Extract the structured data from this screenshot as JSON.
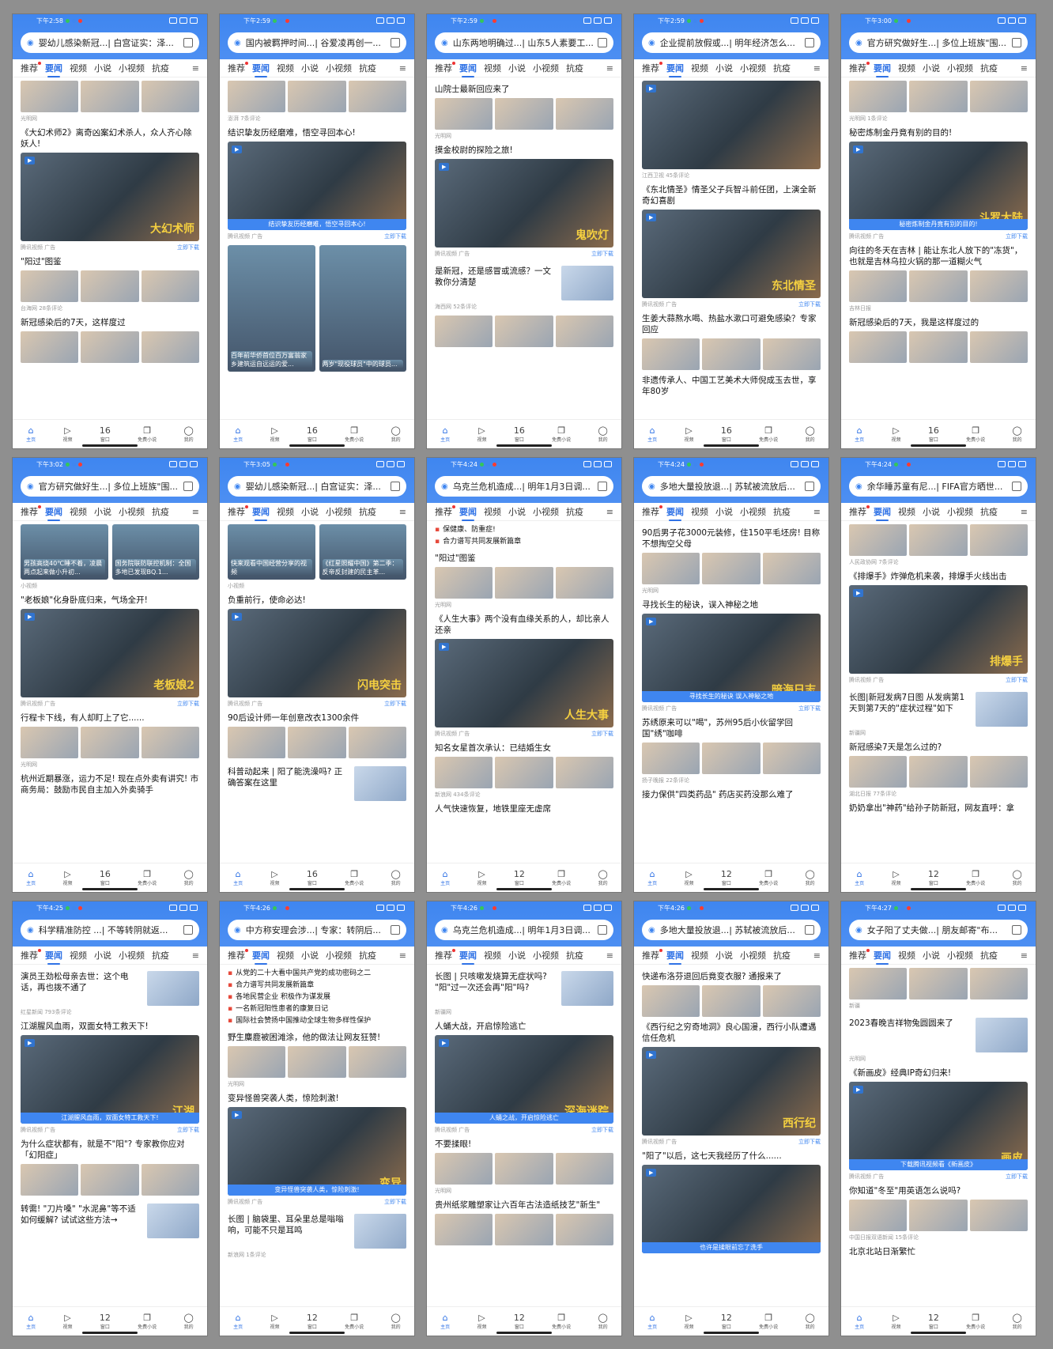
{
  "tabs": [
    "推荐",
    "要闻",
    "视频",
    "小说",
    "小视频",
    "抗疫"
  ],
  "nav": [
    {
      "label": "主页",
      "icon": "home-icon"
    },
    {
      "label": "视频",
      "icon": "play-icon"
    },
    {
      "label": "窗口",
      "icon": "window-icon"
    },
    {
      "label": "免费小说",
      "icon": "book-icon"
    },
    {
      "label": "我的",
      "icon": "user-icon"
    }
  ],
  "screens": [
    {
      "time": "下午2:58",
      "search": "婴幼儿感染新冠...| 白宫证实：泽...",
      "window_count": "16",
      "items": [
        {
          "kind": "row3",
          "meta": "光明网"
        },
        {
          "kind": "big",
          "title": "《大幻术师2》离奇凶案幻术杀人，众人齐心除妖人!",
          "caption": "大幻术师",
          "meta": "腾讯视频  广告",
          "dl": "立即下载"
        },
        {
          "kind": "row3",
          "title": "\"阳过\"图鉴",
          "meta": "台海网 28条评论"
        },
        {
          "kind": "row3",
          "title": "新冠感染后的7天，这样度过",
          "meta": ""
        }
      ]
    },
    {
      "time": "下午2:59",
      "search": "国内被羁押时间...| 谷爱凌再创一...",
      "window_count": "16",
      "items": [
        {
          "kind": "row3",
          "meta": "澎湃 7条评论"
        },
        {
          "kind": "big",
          "title": "结识挚友历经磨难，悟空寻回本心!",
          "banner": "结识挚友历经磨难，悟空寻回本心!",
          "meta": "腾讯视频  广告",
          "dl": "立即下载"
        },
        {
          "kind": "twin",
          "left": "百年前华侨首位百万富翁家乡建筑运自远运的爱...",
          "right": "两岁\"现役球员\"中的球员..."
        }
      ]
    },
    {
      "time": "下午2:59",
      "search": "山东两地明确过...| 山东5人素要工...",
      "window_count": "16",
      "items": [
        {
          "kind": "row3",
          "title": "山院士最新回应来了",
          "meta": "光明网"
        },
        {
          "kind": "big",
          "title": "摸金校尉的探险之旅!",
          "caption": "鬼吹灯",
          "meta": "腾讯视频  广告",
          "dl": "立即下载"
        },
        {
          "kind": "side",
          "title": "是新冠，还是感冒或流感？一文教你分清楚",
          "meta": "海西网 52条评论"
        },
        {
          "kind": "row3",
          "meta": ""
        }
      ]
    },
    {
      "time": "下午2:59",
      "search": "企业提前放假或...| 明年经济怎么...",
      "window_count": "16",
      "items": [
        {
          "kind": "big",
          "meta": "江西卫视 45条评论"
        },
        {
          "kind": "big",
          "title": "《东北情圣》情圣父子兵智斗前任团，上演全新奇幻喜剧",
          "caption": "东北情圣",
          "meta": "腾讯视频  广告",
          "dl": "立即下载"
        },
        {
          "kind": "row3",
          "title": "生姜大蒜熬水喝、热盐水漱口可避免感染？专家回应",
          "meta": ""
        },
        {
          "kind": "plain",
          "title": "非遗传承人、中国工艺美术大师倪成玉去世，享年80岁",
          "meta": ""
        }
      ]
    },
    {
      "time": "下午3:00",
      "search": "官方研究做好生...| 多位上班族\"围...",
      "window_count": "16",
      "items": [
        {
          "kind": "row3",
          "meta": "光明网 1条评论"
        },
        {
          "kind": "big",
          "title": "秘密炼制金丹竟有别的目的!",
          "caption": "斗罗大陆",
          "banner": "秘密炼制金丹竟有别的目的!",
          "meta": "腾讯视频  广告",
          "dl": "立即下载"
        },
        {
          "kind": "row3",
          "title": "向往的冬天在吉林 | 能让东北人放下的\"冻货\"，也就是吉林乌拉火锅的那一道糊火气",
          "meta": "吉林日报"
        },
        {
          "kind": "row3",
          "title": "新冠感染后的7天，我是这样度过的",
          "meta": ""
        }
      ]
    },
    {
      "time": "下午3:02",
      "search": "官方研究做好生...| 多位上班族\"围...",
      "window_count": "16",
      "items": [
        {
          "kind": "twin2",
          "left": "男孩高烧40℃睡不着，凌晨两点起来做小升初...",
          "right": "国务院联防联控机制：全国多地已发现BQ.1...",
          "meta": "小视频"
        },
        {
          "kind": "big",
          "title": "\"老板娘\"化身卧底归来，气场全开!",
          "caption": "老板娘2",
          "meta": "腾讯视频  广告",
          "dl": "立即下载"
        },
        {
          "kind": "row3",
          "title": "行程卡下线，有人却盯上了它......",
          "meta": "光明网"
        },
        {
          "kind": "plain",
          "title": "杭州近期暴涨，运力不足! 现在点外卖有讲究! 市商务局：鼓励市民自主加入外卖骑手",
          "meta": ""
        }
      ]
    },
    {
      "time": "下午3:05",
      "search": "婴幼儿感染新冠...| 白宫证实：泽...",
      "window_count": "16",
      "items": [
        {
          "kind": "twin2",
          "left": "快来观看中国经营分享的视频",
          "right": "《红星照耀中国》第二季：反帝反封建的民主革...",
          "meta": "小视频"
        },
        {
          "kind": "big",
          "title": "负重前行，使命必达!",
          "caption": "闪电突击",
          "meta": "腾讯视频  广告",
          "dl": "立即下载"
        },
        {
          "kind": "row3",
          "title": "90后设计师一年创意改衣1300余件",
          "meta": ""
        },
        {
          "kind": "side",
          "title": "科普动起来 | 阳了能洗澡吗? 正确答案在这里",
          "meta": ""
        }
      ]
    },
    {
      "time": "下午4:24",
      "search": "乌克兰危机造成...| 明年1月3日调...",
      "window_count": "12",
      "items": [
        {
          "kind": "list",
          "lines": [
            "保健康、防重症!",
            "合力谱写共同发展新篇章"
          ]
        },
        {
          "kind": "row3",
          "title": "\"阳过\"图鉴",
          "meta": "光明网"
        },
        {
          "kind": "big",
          "title": "《人生大事》两个没有血缘关系的人，却比亲人还亲",
          "caption": "人生大事",
          "meta": "腾讯视频  广告",
          "dl": "立即下载"
        },
        {
          "kind": "row3",
          "title": "知名女星首次承认：已结婚生女",
          "meta": "新浪网 434条评论"
        },
        {
          "kind": "plain",
          "title": "人气快速恢复，地铁里座无虚席",
          "meta": ""
        }
      ]
    },
    {
      "time": "下午4:24",
      "search": "多地大量投放退...| 苏轼被流放后...",
      "window_count": "12",
      "items": [
        {
          "kind": "row3",
          "title": "90后男子花3000元装修，住150平毛坯房! 目称不想掏空父母",
          "meta": "光明网"
        },
        {
          "kind": "big",
          "title": "寻找长生的秘诀，误入神秘之地",
          "caption": "暗海日志",
          "banner": "寻找长生的秘诀 误入神秘之地",
          "meta": "腾讯视频  广告",
          "dl": "立即下载"
        },
        {
          "kind": "row3",
          "title": "苏绣原来可以\"喝\"，苏州95后小伙留学回国\"绣\"咖啡",
          "meta": "扬子晚报 22条评论"
        },
        {
          "kind": "plain",
          "title": "接力保供\"四类药品\" 药店买药没那么难了",
          "meta": ""
        }
      ]
    },
    {
      "time": "下午4:24",
      "search": "余华睡苏童有尼...| FIFA官方晒世...",
      "window_count": "12",
      "items": [
        {
          "kind": "row3",
          "meta": "人民政协网 7条评论"
        },
        {
          "kind": "big",
          "title": "《排爆手》炸弹危机来袭，排爆手火线出击",
          "caption": "排爆手",
          "meta": "腾讯视频  广告",
          "dl": "立即下载"
        },
        {
          "kind": "side",
          "title": "长图|新冠发病7日图 从发病第1天到第7天的\"症状过程\"如下",
          "meta": "新疆网"
        },
        {
          "kind": "row3",
          "title": "新冠感染7天是怎么过的?",
          "meta": "湖北日报 77条评论"
        },
        {
          "kind": "plain",
          "title": "奶奶拿出\"神药\"给孙子防新冠，网友直呼：拿",
          "meta": ""
        }
      ]
    },
    {
      "time": "下午4:25",
      "search": "科学精准防控 ...| 不等转阴就返...",
      "window_count": "12",
      "items": [
        {
          "kind": "side",
          "title": "演员王劲松母亲去世：这个电话，再也拨不通了",
          "meta": "红星新闻 793条评论"
        },
        {
          "kind": "big",
          "title": "江湖腥风血雨，双面女特工救天下!",
          "caption": "江湖",
          "banner": "江湖腥风血雨，双面女特工救天下!",
          "meta": "腾讯视频  广告",
          "dl": "立即下载"
        },
        {
          "kind": "row3",
          "title": "为什么症状都有，就是不\"阳\"? 专家教你应对「幻阳症」",
          "meta": ""
        },
        {
          "kind": "side",
          "title": "转需! \"刀片嗓\" \"水泥鼻\"等不适如何缓解? 试试这些方法→",
          "meta": ""
        }
      ]
    },
    {
      "time": "下午4:26",
      "search": "中方称安理会涉...| 专家：转阴后...",
      "window_count": "12",
      "items": [
        {
          "kind": "list",
          "lines": [
            "从党的二十大看中国共产党的成功密码之二",
            "合力谱写共同发展新篇章",
            "各地民营企业 积极作为谋发展",
            "一名新冠阳性患者的康复日记",
            "国际社会赞扬中国推动全球生物多样性保护"
          ]
        },
        {
          "kind": "row3",
          "title": "野生麋鹿被困滩涂，他的做法让网友狂赞!",
          "meta": "光明网"
        },
        {
          "kind": "big",
          "title": "变异怪兽突袭人类，惊险刺激!",
          "caption": "变异",
          "banner": "变异怪兽突袭人类，惊险刺激!",
          "meta": "腾讯视频  广告",
          "dl": "立即下载"
        },
        {
          "kind": "side",
          "title": "长图 | 脑袋里、耳朵里总是嗡嗡响，可能不只是耳鸣",
          "meta": "新浪网 1条评论"
        }
      ]
    },
    {
      "time": "下午4:26",
      "search": "乌克兰危机造成...| 明年1月3日调...",
      "window_count": "12",
      "items": [
        {
          "kind": "side",
          "title": "长图 | 只咳嗽发烧算无症状吗? \"阳\"过一次还会再\"阳\"吗?",
          "meta": "新疆网"
        },
        {
          "kind": "big",
          "title": "人蛹大战，开启惊险逃亡",
          "caption": "深海迷踪",
          "banner": "人蛹之战，开启惊险逃亡",
          "meta": "腾讯视频  广告",
          "dl": "立即下载"
        },
        {
          "kind": "row3",
          "title": "不要揉眼!",
          "meta": "光明网"
        },
        {
          "kind": "row3",
          "title": "贵州纸浆雕塑家让六百年古法造纸技艺\"新生\"",
          "meta": ""
        }
      ]
    },
    {
      "time": "下午4:26",
      "search": "多地大量投放退...| 苏轼被流放后...",
      "window_count": "12",
      "items": [
        {
          "kind": "row3",
          "title": "快递布洛芬退回后竟变衣服? 通报来了",
          "meta": ""
        },
        {
          "kind": "big",
          "title": "《西行纪之穷奇地洞》良心国漫，西行小队遭遇信任危机",
          "caption": "西行纪",
          "meta": "腾讯视频  广告",
          "dl": "立即下载"
        },
        {
          "kind": "big",
          "title": "\"阳了\"以后，这七天我经历了什么......",
          "banner": "也许是揉眼前忘了洗手",
          "meta": ""
        }
      ]
    },
    {
      "time": "下午4:27",
      "search": "女子阳了丈夫做...| 朋友邮寄\"布...",
      "window_count": "12",
      "items": [
        {
          "kind": "row3",
          "meta": "新疆"
        },
        {
          "kind": "side",
          "title": "2023春晚吉祥物兔圆圆来了",
          "meta": "光明网"
        },
        {
          "kind": "big",
          "title": "《新画皮》经典IP奇幻归来!",
          "caption": "画皮",
          "banner": "下载腾讯视频看《新画皮》",
          "meta": "腾讯视频  广告",
          "dl": "立即下载"
        },
        {
          "kind": "row3",
          "title": "你知道\"冬至\"用英语怎么说吗?",
          "meta": "中国日报双语新闻 15条评论"
        },
        {
          "kind": "plain",
          "title": "北京北站日渐繁忙",
          "meta": ""
        }
      ]
    }
  ]
}
